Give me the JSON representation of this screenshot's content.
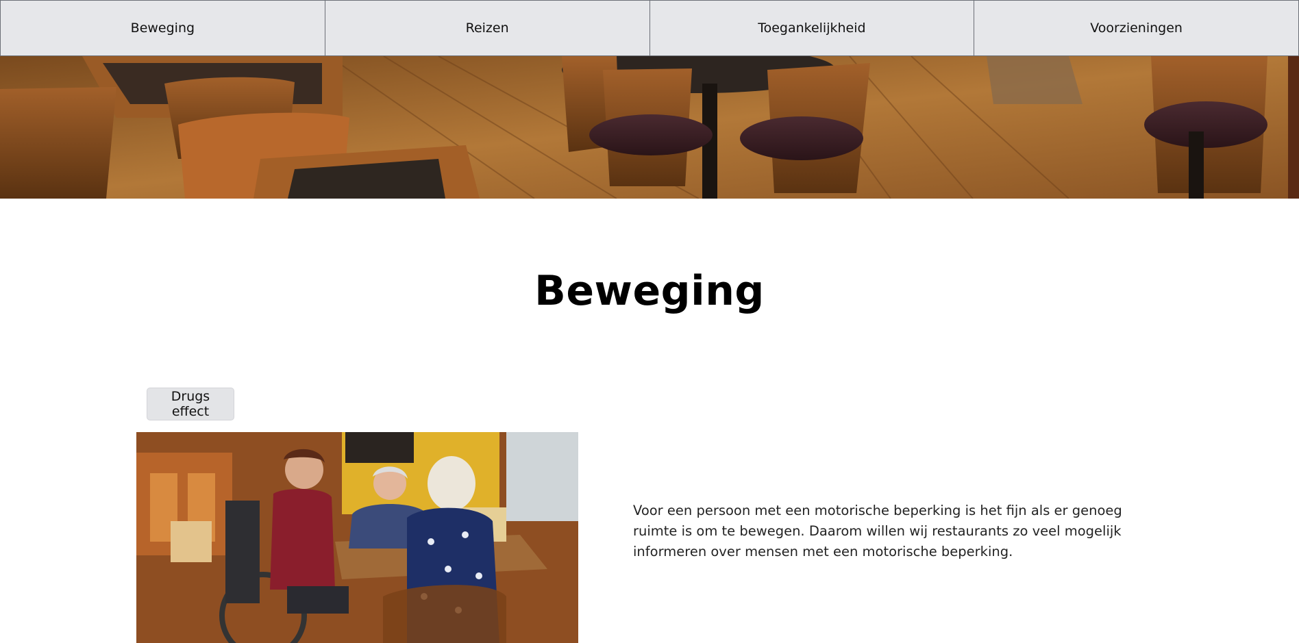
{
  "nav": {
    "items": [
      {
        "label": "Beweging"
      },
      {
        "label": "Reizen"
      },
      {
        "label": "Toegankelijkheid"
      },
      {
        "label": "Voorzieningen"
      }
    ]
  },
  "hero": {
    "image": "restaurant-interior-banner"
  },
  "main": {
    "title": "Beweging",
    "effect_button_label": "Drugs effect",
    "photo": "people-at-restaurant-table-wheelchair",
    "paragraph": "Voor een persoon met een motorische beperking is het fijn als er genoeg ruimte is om te bewegen. Daarom willen wij restaurants zo veel mogelijk informeren over mensen met een motorische beperking."
  },
  "colors": {
    "nav_background": "#e6e7ea",
    "nav_border": "#6b6f76",
    "button_background": "#e3e4e7",
    "text": "#111111"
  }
}
